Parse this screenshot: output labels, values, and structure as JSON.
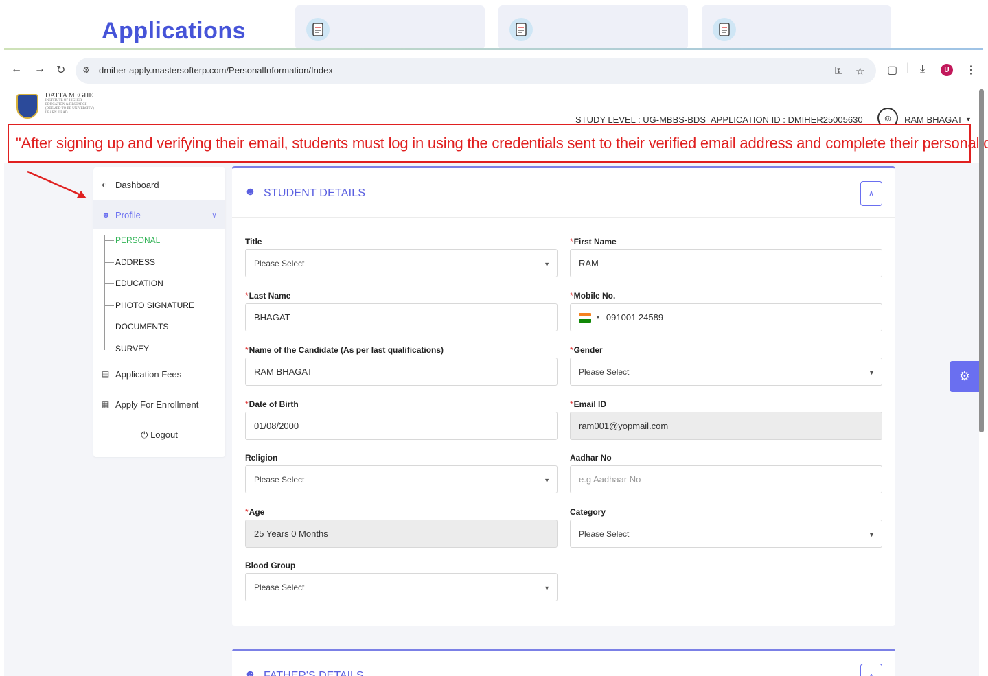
{
  "banner": {
    "title": "Applications"
  },
  "browser": {
    "url": "dmiher-apply.mastersofterp.com/PersonalInformation/Index",
    "profile_initial": "U"
  },
  "header": {
    "logo_lines": [
      "DATTA MEGHE",
      "INSTITUTE OF HIGHER",
      "EDUCATION & RESEARCH",
      "(DEEMED TO BE UNIVERSITY)",
      "LEARN. LEAD."
    ],
    "study_level": "STUDY LEVEL : UG-MBBS-BDS",
    "application_id": "APPLICATION ID : DMIHER25005630",
    "user_name": "RAM BHAGAT"
  },
  "annotation": {
    "text": "\"After signing up and verifying their email, students must log in using the credentials sent to their verified email address and complete their personal details.\""
  },
  "sidebar": {
    "dashboard": "Dashboard",
    "profile": "Profile",
    "sub_items": [
      "PERSONAL",
      "ADDRESS",
      "EDUCATION",
      "PHOTO SIGNATURE",
      "DOCUMENTS",
      "SURVEY"
    ],
    "application_fees": "Application Fees",
    "apply_enrollment": "Apply For Enrollment",
    "logout": "Logout"
  },
  "student_details": {
    "title": "STUDENT DETAILS",
    "fields": {
      "title_label": "Title",
      "title_value": "Please Select",
      "first_name_label": "First Name",
      "first_name_value": "RAM",
      "last_name_label": "Last Name",
      "last_name_value": "BHAGAT",
      "mobile_label": "Mobile No.",
      "mobile_value": "091001 24589",
      "candidate_name_label": "Name of the Candidate (As per last qualifications)",
      "candidate_name_value": "RAM BHAGAT",
      "gender_label": "Gender",
      "gender_value": "Please Select",
      "dob_label": "Date of Birth",
      "dob_value": "01/08/2000",
      "email_label": "Email ID",
      "email_value": "ram001@yopmail.com",
      "religion_label": "Religion",
      "religion_value": "Please Select",
      "aadhar_label": "Aadhar No",
      "aadhar_placeholder": "e.g Aadhaar No",
      "age_label": "Age",
      "age_value": "25 Years 0 Months",
      "category_label": "Category",
      "category_value": "Please Select",
      "blood_group_label": "Blood Group",
      "blood_group_value": "Please Select"
    }
  },
  "fathers_details": {
    "title": "FATHER'S DETAILS"
  }
}
